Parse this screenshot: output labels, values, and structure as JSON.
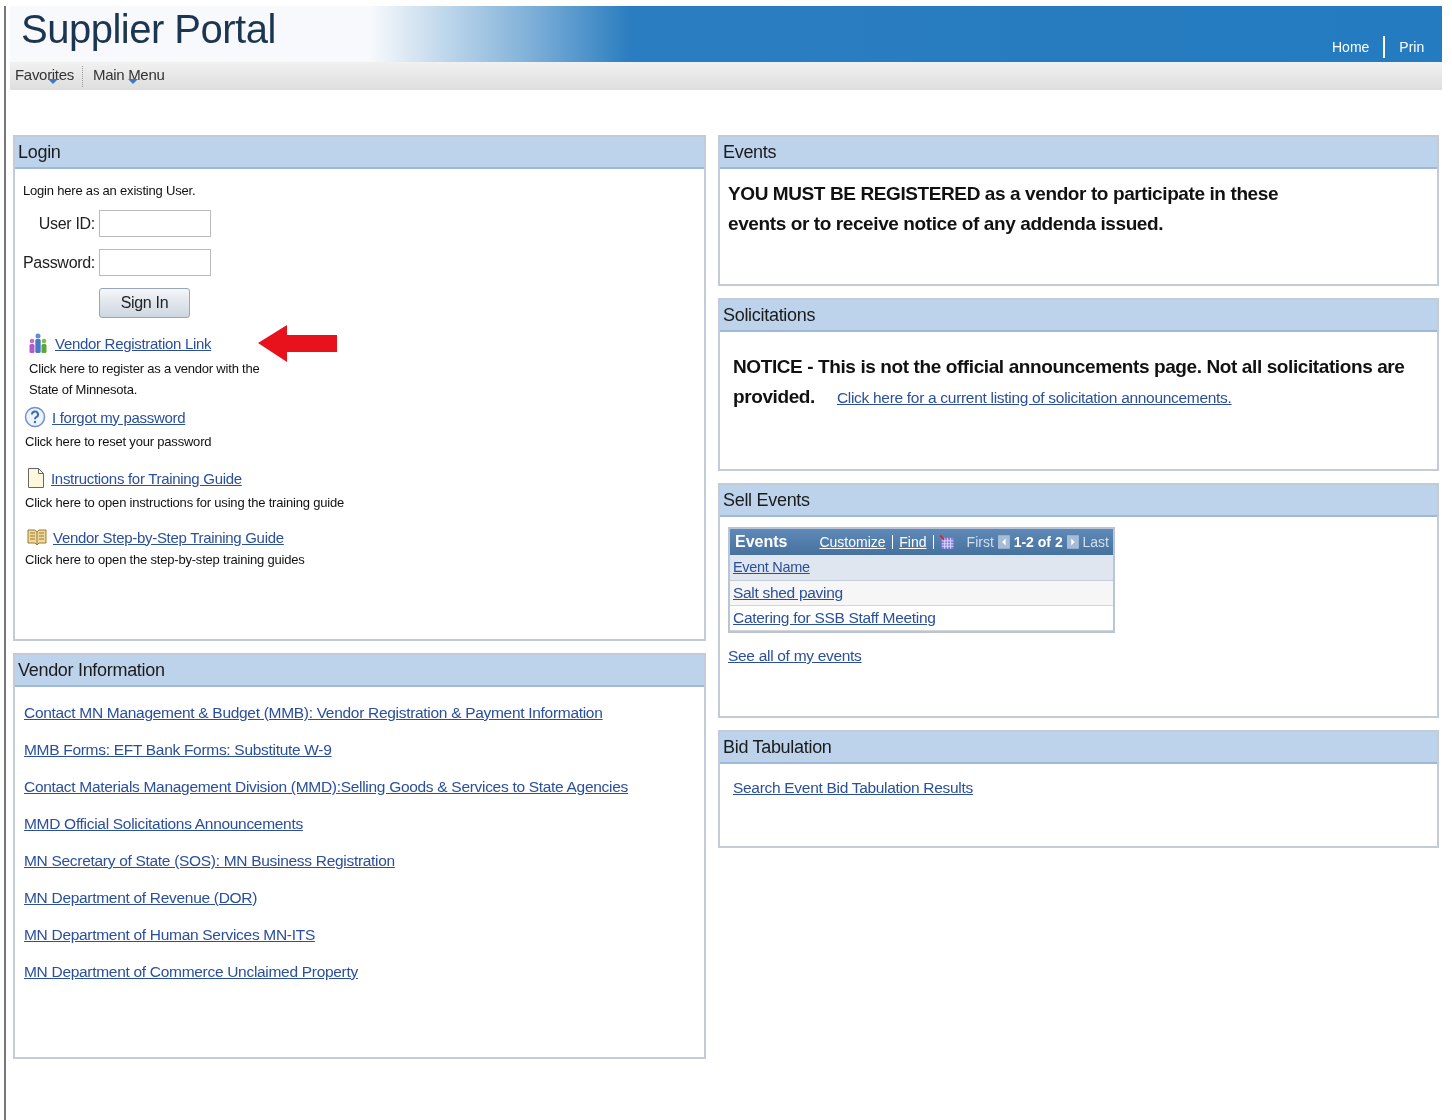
{
  "header": {
    "title": "Supplier Portal",
    "links": [
      "Home",
      "Prin"
    ]
  },
  "menu": [
    {
      "label": "Favorites"
    },
    {
      "label": "Main Menu"
    }
  ],
  "login": {
    "title": "Login",
    "intro": "Login here as an existing User.",
    "fields": [
      {
        "label": "User ID:"
      },
      {
        "label": "Password:"
      }
    ],
    "button": "Sign In",
    "items": [
      {
        "kind": "people",
        "link": "Vendor Registration Link",
        "desc": "Click here to register as a vendor with the State of Minnesota.",
        "pointed": true
      },
      {
        "kind": "help",
        "link": "I forgot my password",
        "desc": "Click here to reset your password",
        "pointed": false
      },
      {
        "kind": "page",
        "link": "Instructions for Training Guide",
        "desc": "Click here to open instructions for using the training guide",
        "pointed": false
      },
      {
        "kind": "book",
        "link": "Vendor Step-by-Step Training Guide",
        "desc": "Click here to open the step-by-step training guides",
        "pointed": false
      }
    ]
  },
  "vendor_information": {
    "title": "Vendor Information",
    "links": [
      "Contact MN Management & Budget (MMB): Vendor Registration & Payment Information",
      "MMB Forms: EFT Bank Forms: Substitute W-9",
      "Contact Materials Management Division (MMD):Selling Goods & Services to State Agencies",
      "MMD Official Solicitations Announcements",
      "MN Secretary of State (SOS): MN Business Registration",
      "MN Department of Revenue (DOR)",
      "MN Department of Human Services MN-ITS",
      "MN Department of Commerce Unclaimed Property"
    ]
  },
  "events": {
    "title": "Events",
    "notice": "YOU MUST BE REGISTERED as a vendor to participate in these events or to receive notice of any addenda issued."
  },
  "solicitations": {
    "title": "Solicitations",
    "notice": "NOTICE - This is not the official announcements page. Not all solicitations are provided.",
    "link": "Click here for a current listing of solicitation announcements."
  },
  "sell_events": {
    "title": "Sell Events",
    "grid": {
      "title": "Events",
      "tools": [
        "Customize",
        "Find"
      ],
      "first": {
        "label": "First",
        "disabled": true
      },
      "range": "1-2 of 2",
      "last": {
        "label": "Last",
        "disabled": true
      },
      "column": "Event Name",
      "rows": [
        "Salt shed paving",
        "Catering for SSB Staff Meeting"
      ]
    },
    "footer_link": "See all of my events"
  },
  "bid_tabulation": {
    "title": "Bid Tabulation",
    "link": "Search Event Bid Tabulation Results"
  }
}
